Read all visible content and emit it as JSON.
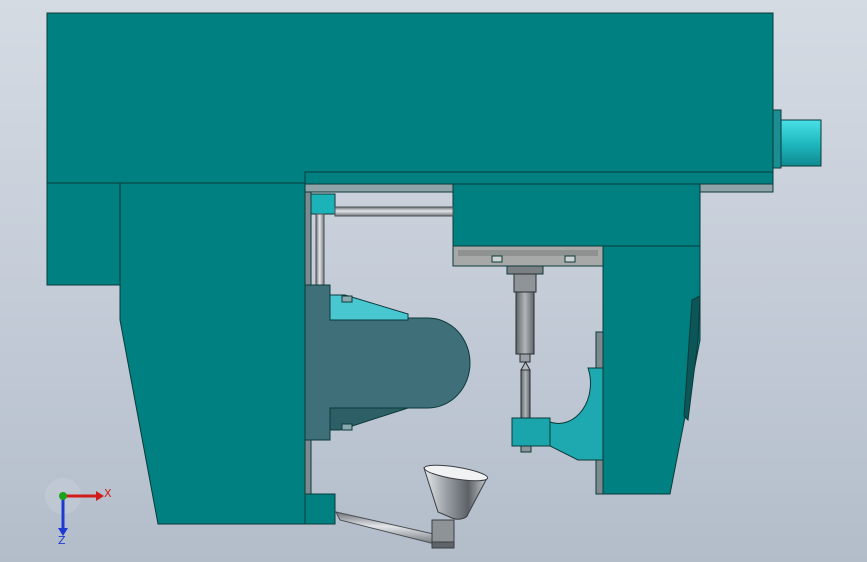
{
  "viewport": {
    "background_top": "#d5dbe3",
    "background_bottom": "#b3bdca"
  },
  "colors": {
    "body": "#008080",
    "body_edge": "#0b3a3a",
    "cyan_part": "#2fcfd6",
    "dark_teal": "#3f7079",
    "steel": "#9aa0a6",
    "axis_x": "#d21c1c",
    "axis_y": "#1ca21c",
    "axis_z": "#1c3ad2"
  },
  "triad": {
    "x_label": "X",
    "z_label": "Z"
  }
}
